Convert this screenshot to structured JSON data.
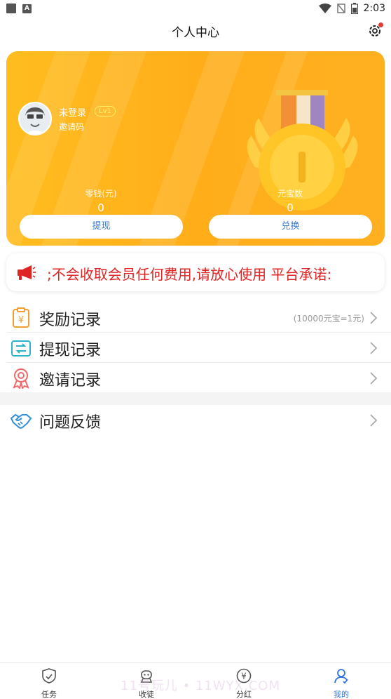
{
  "status_bar": {
    "time": "2:03",
    "battery_icon": "battery-icon",
    "wifi_icon": "wifi-icon",
    "signal_icon": "no-signal-icon"
  },
  "header": {
    "title": "个人中心",
    "settings_icon": "settings-icon"
  },
  "profile": {
    "name": "未登录",
    "level": "Lv1",
    "invite_code_label": "邀请码",
    "money_label": "零钱(元)",
    "money_value": "0",
    "yuanbao_label": "元宝数",
    "yuanbao_value": "0",
    "withdraw_button": "提现",
    "exchange_button": "兑换"
  },
  "notice": {
    "text": ";不会收取会员任何费用,请放心使用  平台承诺:"
  },
  "menu": {
    "rewards": {
      "label": "奖励记录",
      "hint": "(10000元宝=1元)"
    },
    "withdrawals": {
      "label": "提现记录"
    },
    "invites": {
      "label": "邀请记录"
    },
    "feedback": {
      "label": "问题反馈"
    }
  },
  "tabbar": {
    "tasks": "任务",
    "apprentices": "收徒",
    "dividends": "分红",
    "mine": "我的"
  },
  "watermark": "11号玩儿 • 11WYX.COM",
  "colors": {
    "card": "#ffb21e",
    "accent": "#2f74e0",
    "notice": "#e02424"
  }
}
